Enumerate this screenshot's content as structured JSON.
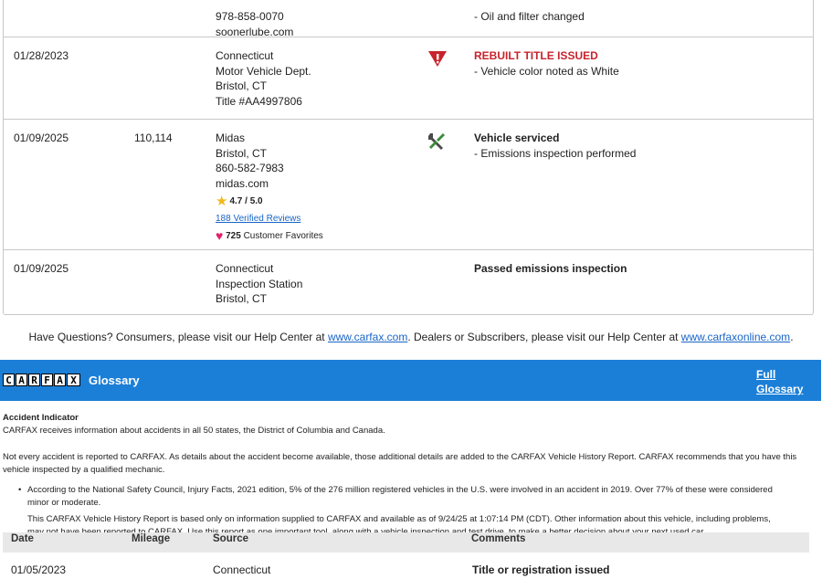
{
  "top_partial": {
    "phone": "978-858-0070",
    "site": "soonerlube.com",
    "comment": "Oil and filter changed"
  },
  "records": [
    {
      "date": "01/28/2023",
      "mileage": "",
      "source": [
        "Connecticut",
        "Motor Vehicle Dept.",
        "Bristol, CT",
        "Title #AA4997806"
      ],
      "icon": "warning-shield-icon",
      "comment_title": "REBUILT TITLE ISSUED",
      "comments": [
        "Vehicle color noted as White"
      ]
    },
    {
      "date": "01/09/2025",
      "mileage": "110,114",
      "source": [
        "Midas",
        "Bristol, CT",
        "860-582-7983",
        "midas.com"
      ],
      "rating": "4.7 / 5.0",
      "reviews": "188 Verified Reviews",
      "favorites_count": "725",
      "favorites_label": "Customer Favorites",
      "icon": "tools-icon",
      "comment_title": "Vehicle serviced",
      "comments": [
        "Emissions inspection performed"
      ]
    },
    {
      "date": "01/09/2025",
      "mileage": "",
      "source": [
        "Connecticut",
        "Inspection Station",
        "Bristol, CT"
      ],
      "comment_title": "Passed emissions inspection"
    }
  ],
  "help": {
    "pre": "Have Questions? Consumers, please visit our Help Center at ",
    "link1": "www.carfax.com",
    "mid": ". Dealers or Subscribers, please visit our Help Center at ",
    "link2": "www.carfaxonline.com",
    "post": "."
  },
  "glossary": {
    "logo_letters": [
      "C",
      "A",
      "R",
      "F",
      "A",
      "X"
    ],
    "title": "Glossary",
    "full_link_line1": "Full",
    "full_link_line2": "Glossary",
    "heading": "Accident Indicator",
    "p1": "CARFAX receives information about accidents in all 50 states, the District of Columbia and Canada.",
    "p2": "Not every accident is reported to CARFAX. As details about the accident become available, those additional details are added to the CARFAX Vehicle History Report. CARFAX recommends that you have this vehicle inspected by a qualified mechanic.",
    "b1": "According to the National Safety Council, Injury Facts, 2021 edition, 5% of the 276 million registered vehicles in the U.S. were involved in an accident in 2019. Over 77% of these were considered minor or moderate.",
    "b2": "This CARFAX Vehicle History Report is based only on information supplied to CARFAX and available as of 9/24/25 at 1:07:14 PM (CDT). Other information about this vehicle, including problems, may not have been reported to CARFAX. Use this report as one important tool, along with a vehicle inspection and test drive, to make a better decision about your next used car."
  },
  "bottom_table": {
    "headers": [
      "Date",
      "Mileage",
      "Source",
      "Comments"
    ],
    "row": {
      "date": "01/05/2023",
      "source": "Connecticut",
      "comment": "Title or registration issued"
    }
  },
  "colors": {
    "accent_blue": "#1c7fd7",
    "alert_red": "#c8232c",
    "link_blue": "#1965c7"
  }
}
